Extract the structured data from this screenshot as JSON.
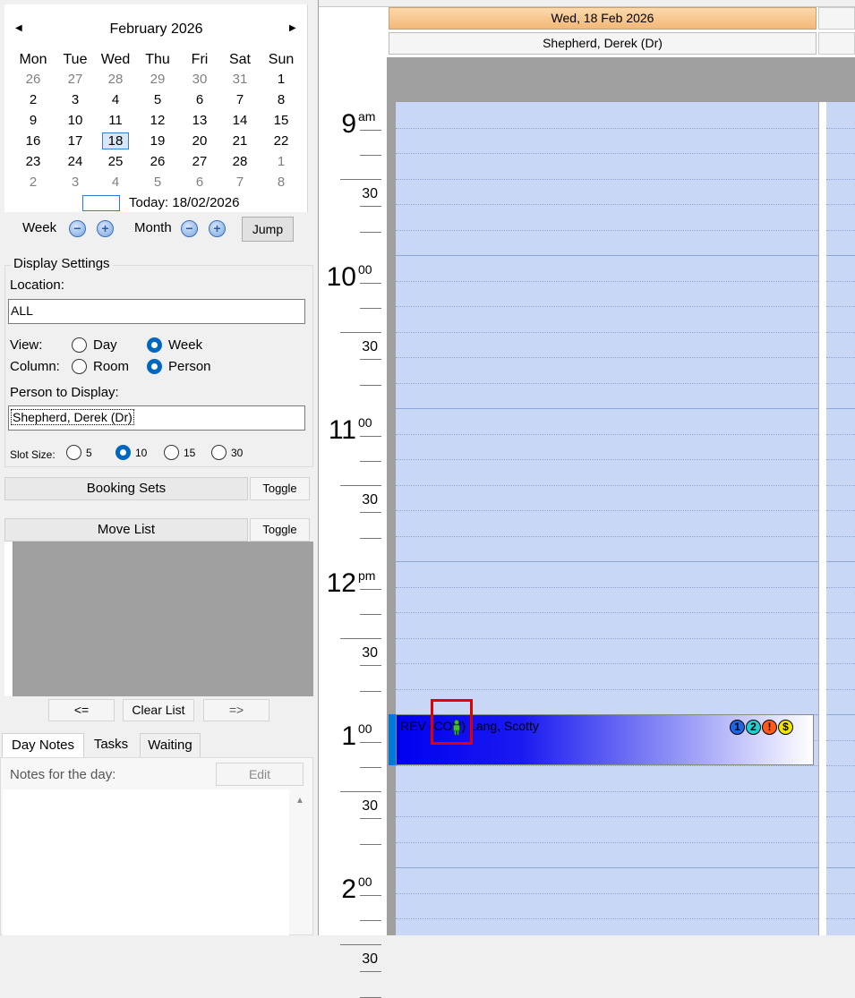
{
  "calendar": {
    "title": "February 2026",
    "prev_arrow": "◀",
    "next_arrow": "▶",
    "weekdays": [
      "Mon",
      "Tue",
      "Wed",
      "Thu",
      "Fri",
      "Sat",
      "Sun"
    ],
    "weeks": [
      [
        "26",
        "27",
        "28",
        "29",
        "30",
        "31",
        "1"
      ],
      [
        "2",
        "3",
        "4",
        "5",
        "6",
        "7",
        "8"
      ],
      [
        "9",
        "10",
        "11",
        "12",
        "13",
        "14",
        "15"
      ],
      [
        "16",
        "17",
        "18",
        "19",
        "20",
        "21",
        "22"
      ],
      [
        "23",
        "24",
        "25",
        "26",
        "27",
        "28",
        "1"
      ],
      [
        "2",
        "3",
        "4",
        "5",
        "6",
        "7",
        "8"
      ]
    ],
    "selected_day": "18",
    "today_label": "Today: 18/02/2026"
  },
  "nav": {
    "week_label": "Week",
    "month_label": "Month",
    "jump_label": "Jump",
    "minus": "−",
    "plus": "+"
  },
  "display_settings": {
    "legend": "Display Settings",
    "location_label": "Location:",
    "location_value": "ALL",
    "view_label": "View:",
    "view_options": [
      "Day",
      "Week"
    ],
    "view_selected": "Week",
    "column_label": "Column:",
    "column_options": [
      "Room",
      "Person"
    ],
    "column_selected": "Person",
    "person_label": "Person to Display:",
    "person_value": "Shepherd, Derek (Dr)",
    "slot_label": "Slot Size:",
    "slot_options": [
      "5",
      "10",
      "15",
      "30"
    ],
    "slot_selected": "10"
  },
  "booking_sets": {
    "label": "Booking Sets",
    "toggle": "Toggle"
  },
  "move_list": {
    "label": "Move List",
    "toggle": "Toggle",
    "prev": "<=",
    "clear": "Clear List",
    "next": "=>"
  },
  "tabs": [
    "Day Notes",
    "Tasks",
    "Waiting"
  ],
  "notes": {
    "label": "Notes for the day:",
    "edit": "Edit",
    "scroll_up": "▲"
  },
  "schedule": {
    "date_header": "Wed, 18 Feb 2026",
    "person_header": "Shepherd, Derek (Dr)",
    "hours": [
      {
        "h": "9",
        "suffix": "am"
      },
      {
        "h": "10",
        "suffix": "00"
      },
      {
        "h": "11",
        "suffix": "00"
      },
      {
        "h": "12",
        "suffix": "pm"
      },
      {
        "h": "1",
        "suffix": "00"
      },
      {
        "h": "2",
        "suffix": "00"
      }
    ],
    "half_label": "30"
  },
  "appointment": {
    "text": "REV    (CON) Lang, Scotty",
    "icons": [
      "1",
      "2",
      "!",
      "$"
    ],
    "icon_colors": [
      "#1e66e6",
      "#22cccc",
      "#ff5a1a",
      "#f2e600"
    ]
  }
}
